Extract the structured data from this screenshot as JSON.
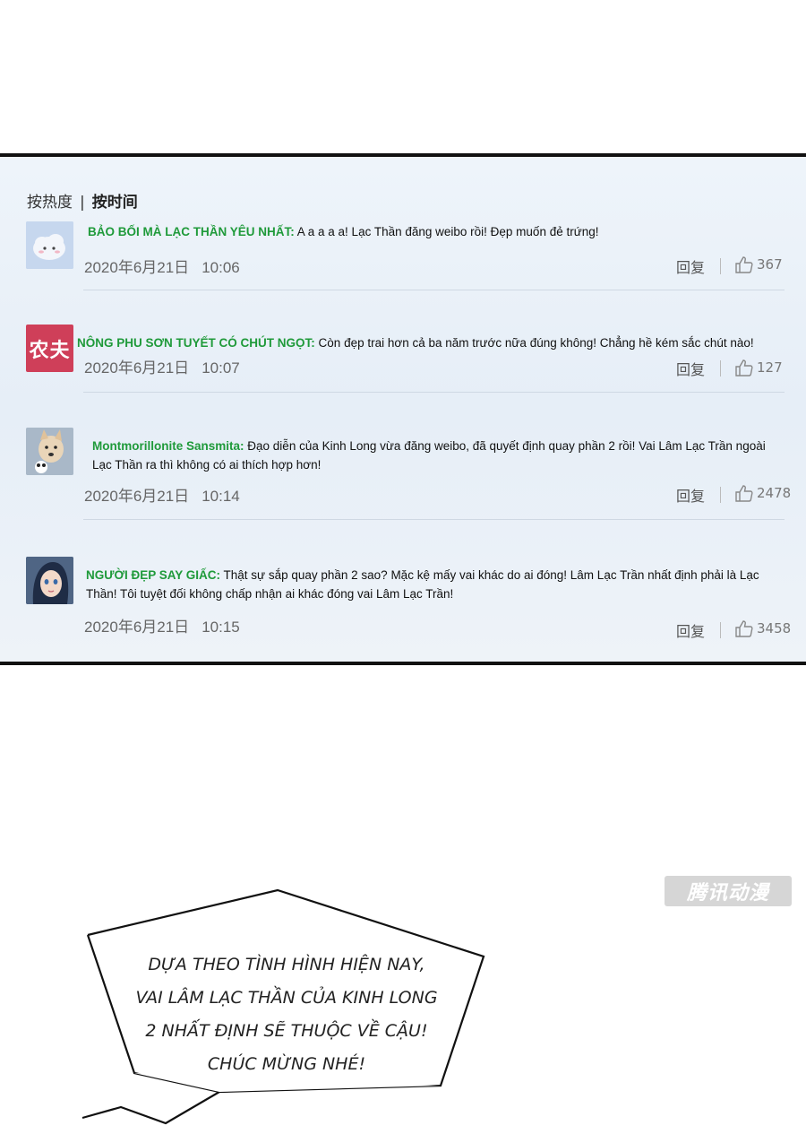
{
  "sort": {
    "hot": "按热度",
    "separator": "|",
    "time": "按时间"
  },
  "comments": [
    {
      "user": "BẢO BỐI MÀ LẠC THẦN YÊU NHẤT:",
      "text": "A a a a a! Lạc Thần đăng weibo rồi! Đẹp muốn đẻ trứng!",
      "date": "2020年6月21日",
      "time": "10:06",
      "reply": "回复",
      "likes": "367",
      "avatar": "cloud-avatar-icon"
    },
    {
      "user": "NÔNG PHU SƠN TUYẾT CÓ CHÚT NGỌT:",
      "text": "Còn đẹp trai hơn cả ba năm trước nữa đúng không! Chẳng hề kém sắc chút nào!",
      "date": "2020年6月21日",
      "time": "10:07",
      "reply": "回复",
      "likes": "127",
      "avatar": "农夫"
    },
    {
      "user": "Montmorillonite Sansmita:",
      "text": "Đạo diễn của Kinh Long vừa đăng weibo, đã quyết định quay phần 2 rồi! Vai Lâm Lạc Trần ngoài Lạc Thần ra thì không có ai thích hợp hơn!",
      "date": "2020年6月21日",
      "time": "10:14",
      "reply": "回复",
      "likes": "2478",
      "avatar": "dog-avatar-icon"
    },
    {
      "user": "NGƯỜI ĐẸP SAY GIẤC:",
      "text": "Thật sự sắp quay phần 2 sao? Mặc kệ mấy vai khác do ai đóng! Lâm Lạc Trần nhất định phải là Lạc Thần! Tôi tuyệt đối không chấp nhận ai khác đóng vai Lâm Lạc Trần!",
      "date": "2020年6月21日",
      "time": "10:15",
      "reply": "回复",
      "likes": "3458",
      "avatar": "girl-avatar-icon"
    }
  ],
  "watermark": "腾讯动漫",
  "bubble": {
    "text": "DỰA THEO TÌNH HÌNH HIỆN NAY, VAI LÂM LẠC THẦN CỦA KINH LONG 2 NHẤT ĐỊNH SẼ THUỘC VỀ CẬU! CHÚC MỪNG NHÉ!"
  }
}
